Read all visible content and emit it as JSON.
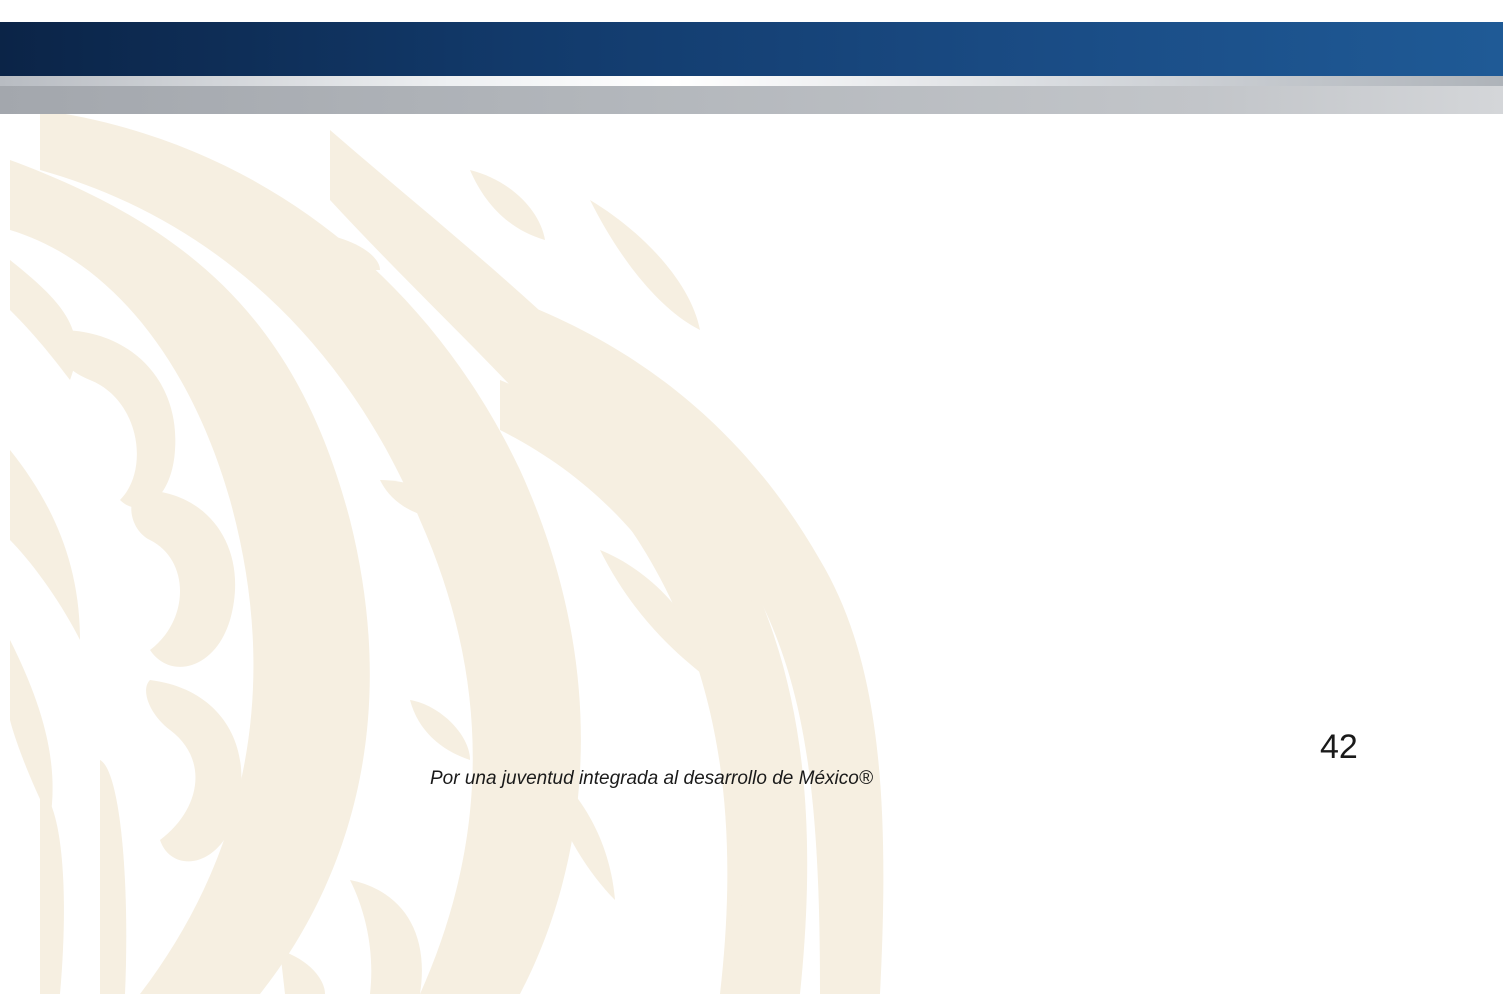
{
  "footer": {
    "slogan": "Por una juventud integrada al desarrollo de México®"
  },
  "page": {
    "number": "42"
  },
  "colors": {
    "header_band": "#123a6b",
    "header_bar": "#b2b6bb",
    "watermark": "#f4ead9"
  },
  "decor": {
    "watermark_icon": "eagle-pattern-watermark-icon"
  }
}
